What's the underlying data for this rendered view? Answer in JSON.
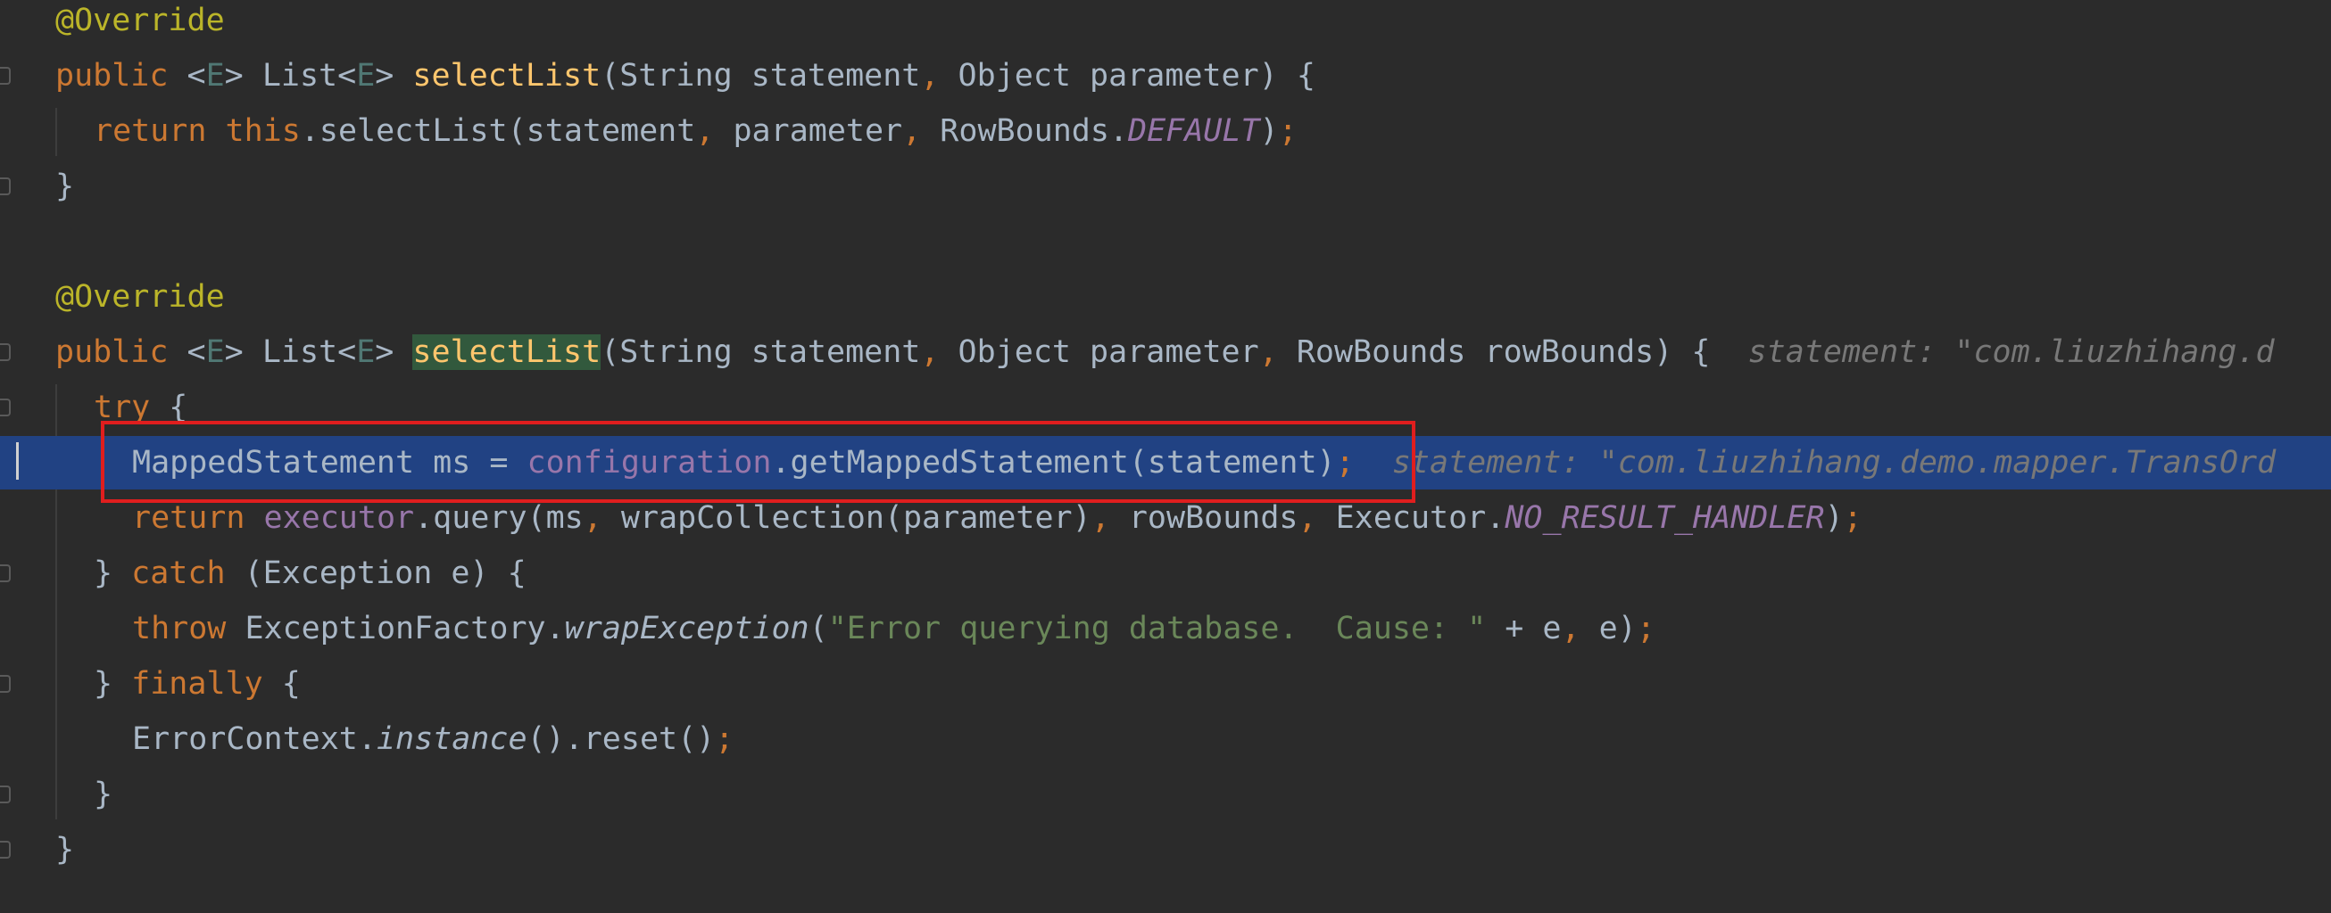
{
  "editor": {
    "theme_colors": {
      "background": "#2b2b2b",
      "keyword": "#cc7832",
      "annotation": "#bbb529",
      "method_declaration": "#ffc66d",
      "field": "#9876aa",
      "string": "#6a8759",
      "plain": "#a9b7c6",
      "inlay_hint": "#787878",
      "current_line": "#214283",
      "highlight_box": "#e01e1e"
    },
    "highlighted_line_index": 8,
    "lines": [
      {
        "indent": 0,
        "tokens": [
          {
            "t": "@Override",
            "c": "annotation"
          }
        ]
      },
      {
        "indent": 0,
        "tokens": [
          {
            "t": "public ",
            "c": "keyword"
          },
          {
            "t": "<",
            "c": "plain"
          },
          {
            "t": "E",
            "c": "type-param"
          },
          {
            "t": "> List<",
            "c": "plain"
          },
          {
            "t": "E",
            "c": "type-param"
          },
          {
            "t": "> ",
            "c": "plain"
          },
          {
            "t": "selectList",
            "c": "method-decl"
          },
          {
            "t": "(String statement",
            "c": "plain"
          },
          {
            "t": ", ",
            "c": "punct"
          },
          {
            "t": "Object parameter) {",
            "c": "plain"
          }
        ]
      },
      {
        "indent": 1,
        "tokens": [
          {
            "t": "return ",
            "c": "keyword"
          },
          {
            "t": "this",
            "c": "keyword"
          },
          {
            "t": ".selectList(statement",
            "c": "plain"
          },
          {
            "t": ", ",
            "c": "punct"
          },
          {
            "t": "parameter",
            "c": "plain"
          },
          {
            "t": ", ",
            "c": "punct"
          },
          {
            "t": "RowBounds.",
            "c": "plain"
          },
          {
            "t": "DEFAULT",
            "c": "static-field"
          },
          {
            "t": ")",
            "c": "plain"
          },
          {
            "t": ";",
            "c": "punct"
          }
        ]
      },
      {
        "indent": 0,
        "tokens": [
          {
            "t": "}",
            "c": "plain"
          }
        ]
      },
      {
        "indent": 0,
        "tokens": []
      },
      {
        "indent": 0,
        "tokens": [
          {
            "t": "@Override",
            "c": "annotation"
          }
        ]
      },
      {
        "indent": 0,
        "tokens": [
          {
            "t": "public ",
            "c": "keyword"
          },
          {
            "t": "<",
            "c": "plain"
          },
          {
            "t": "E",
            "c": "type-param"
          },
          {
            "t": "> List<",
            "c": "plain"
          },
          {
            "t": "E",
            "c": "type-param"
          },
          {
            "t": "> ",
            "c": "plain"
          },
          {
            "t": "selectList",
            "c": "method-match"
          },
          {
            "t": "(String statement",
            "c": "plain"
          },
          {
            "t": ", ",
            "c": "punct"
          },
          {
            "t": "Object parameter",
            "c": "plain"
          },
          {
            "t": ", ",
            "c": "punct"
          },
          {
            "t": "RowBounds rowBounds) {",
            "c": "plain"
          },
          {
            "t": "  statement: \"com.liuzhihang.d",
            "c": "hint"
          }
        ]
      },
      {
        "indent": 1,
        "tokens": [
          {
            "t": "try ",
            "c": "keyword"
          },
          {
            "t": "{",
            "c": "plain"
          }
        ]
      },
      {
        "indent": 2,
        "tokens": [
          {
            "t": "MappedStatement ms = ",
            "c": "plain"
          },
          {
            "t": "configuration",
            "c": "field"
          },
          {
            "t": ".getMappedStatement(statement)",
            "c": "plain"
          },
          {
            "t": ";",
            "c": "punct"
          },
          {
            "t": "  statement: \"com.liuzhihang.demo.mapper.TransOrd",
            "c": "hint"
          }
        ]
      },
      {
        "indent": 2,
        "tokens": [
          {
            "t": "return ",
            "c": "keyword"
          },
          {
            "t": "executor",
            "c": "field"
          },
          {
            "t": ".query(ms",
            "c": "plain"
          },
          {
            "t": ", ",
            "c": "punct"
          },
          {
            "t": "wrapCollection(parameter)",
            "c": "plain"
          },
          {
            "t": ", ",
            "c": "punct"
          },
          {
            "t": "rowBounds",
            "c": "plain"
          },
          {
            "t": ", ",
            "c": "punct"
          },
          {
            "t": "Executor.",
            "c": "plain"
          },
          {
            "t": "NO_RESULT_HANDLER",
            "c": "static-field"
          },
          {
            "t": ")",
            "c": "plain"
          },
          {
            "t": ";",
            "c": "punct"
          }
        ]
      },
      {
        "indent": 1,
        "tokens": [
          {
            "t": "} ",
            "c": "plain"
          },
          {
            "t": "catch ",
            "c": "keyword"
          },
          {
            "t": "(Exception e) {",
            "c": "plain"
          }
        ]
      },
      {
        "indent": 2,
        "tokens": [
          {
            "t": "throw ",
            "c": "keyword"
          },
          {
            "t": "ExceptionFactory.",
            "c": "plain"
          },
          {
            "t": "wrapException",
            "c": "static-call"
          },
          {
            "t": "(",
            "c": "plain"
          },
          {
            "t": "\"Error querying database.  Cause: \"",
            "c": "string"
          },
          {
            "t": " + e",
            "c": "plain"
          },
          {
            "t": ", ",
            "c": "punct"
          },
          {
            "t": "e)",
            "c": "plain"
          },
          {
            "t": ";",
            "c": "punct"
          }
        ]
      },
      {
        "indent": 1,
        "tokens": [
          {
            "t": "} ",
            "c": "plain"
          },
          {
            "t": "finally ",
            "c": "keyword"
          },
          {
            "t": "{",
            "c": "plain"
          }
        ]
      },
      {
        "indent": 2,
        "tokens": [
          {
            "t": "ErrorContext.",
            "c": "plain"
          },
          {
            "t": "instance",
            "c": "static-call"
          },
          {
            "t": "().reset()",
            "c": "plain"
          },
          {
            "t": ";",
            "c": "punct"
          }
        ]
      },
      {
        "indent": 1,
        "tokens": [
          {
            "t": "}",
            "c": "plain"
          }
        ]
      },
      {
        "indent": 0,
        "tokens": [
          {
            "t": "}",
            "c": "plain"
          }
        ]
      }
    ]
  }
}
